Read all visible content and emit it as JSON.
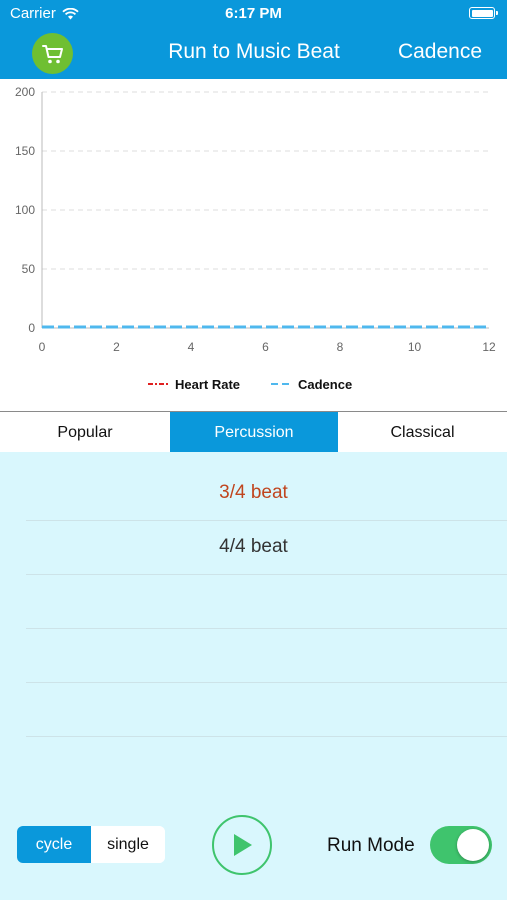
{
  "status_bar": {
    "carrier": "Carrier",
    "time": "6:17 PM"
  },
  "nav": {
    "title": "Run to Music Beat",
    "right_label": "Cadence",
    "accent": "#0a98db"
  },
  "chart_data": {
    "type": "line",
    "title": "",
    "xlabel": "",
    "ylabel": "",
    "xlim": [
      0,
      12
    ],
    "ylim": [
      0,
      200
    ],
    "x_ticks": [
      0,
      2,
      4,
      6,
      8,
      10,
      12
    ],
    "y_ticks": [
      0,
      50,
      100,
      150,
      200
    ],
    "grid": true,
    "legend_position": "bottom",
    "series": [
      {
        "name": "Heart Rate",
        "color": "#e02020",
        "style": "dash-dot",
        "x": [],
        "y": []
      },
      {
        "name": "Cadence",
        "color": "#4fb8ee",
        "style": "dashed",
        "x": [
          0,
          12
        ],
        "y": [
          0,
          0
        ]
      }
    ]
  },
  "segments": [
    {
      "label": "Popular",
      "active": false
    },
    {
      "label": "Percussion",
      "active": true
    },
    {
      "label": "Classical",
      "active": false
    }
  ],
  "beats": [
    {
      "label": "3/4 beat",
      "selected": true
    },
    {
      "label": "4/4 beat",
      "selected": false
    },
    {
      "label": "",
      "selected": false
    },
    {
      "label": "",
      "selected": false
    },
    {
      "label": "",
      "selected": false
    }
  ],
  "controls": {
    "cycle_label": "cycle",
    "single_label": "single",
    "run_mode_label": "Run Mode",
    "run_mode_on": true,
    "play_icon": "play-icon"
  }
}
